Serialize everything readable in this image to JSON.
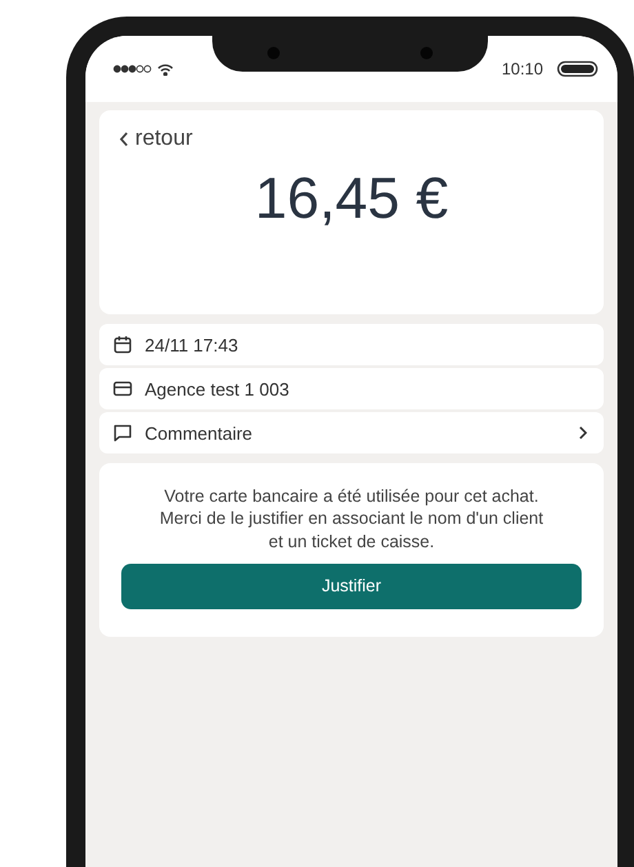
{
  "status_bar": {
    "time": "10:10"
  },
  "back_link": {
    "label": "retour"
  },
  "amount": "16,45 €",
  "details": [
    {
      "kind": "date",
      "text": "24/11 17:43",
      "navigable": false
    },
    {
      "kind": "card",
      "text": "Agence test 1 003",
      "navigable": false
    },
    {
      "kind": "comment",
      "text": "Commentaire",
      "navigable": true
    }
  ],
  "notice": {
    "text": "Votre carte bancaire a été utilisée pour cet achat.\nMerci de le justifier en associant le nom d'un client\net un ticket de caisse."
  },
  "button": {
    "label": "Justifier"
  }
}
